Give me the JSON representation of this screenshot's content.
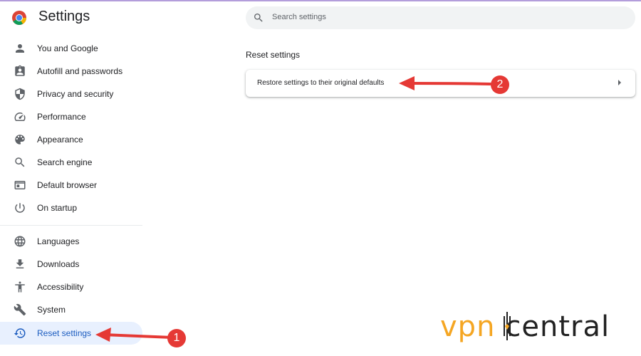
{
  "app": {
    "title": "Settings"
  },
  "search": {
    "placeholder": "Search settings"
  },
  "sidebar": {
    "items": [
      {
        "label": "You and Google",
        "icon": "person-icon"
      },
      {
        "label": "Autofill and passwords",
        "icon": "clipboard-icon"
      },
      {
        "label": "Privacy and security",
        "icon": "shield-icon"
      },
      {
        "label": "Performance",
        "icon": "speedometer-icon"
      },
      {
        "label": "Appearance",
        "icon": "palette-icon"
      },
      {
        "label": "Search engine",
        "icon": "search-icon"
      },
      {
        "label": "Default browser",
        "icon": "browser-icon"
      },
      {
        "label": "On startup",
        "icon": "power-icon"
      },
      {
        "label": "Languages",
        "icon": "globe-icon"
      },
      {
        "label": "Downloads",
        "icon": "download-icon"
      },
      {
        "label": "Accessibility",
        "icon": "accessibility-icon"
      },
      {
        "label": "System",
        "icon": "wrench-icon"
      },
      {
        "label": "Reset settings",
        "icon": "history-icon",
        "active": true
      }
    ]
  },
  "main": {
    "section_title": "Reset settings",
    "restore_label": "Restore settings to their original defaults"
  },
  "annotations": {
    "step1": "1",
    "step2": "2"
  },
  "watermark": {
    "vpn": "vpn",
    "central": "central"
  },
  "colors": {
    "accent": "#1a5bbf",
    "active_bg": "#e8f0fe",
    "annotation": "#e53935",
    "watermark_orange": "#f5a623"
  }
}
